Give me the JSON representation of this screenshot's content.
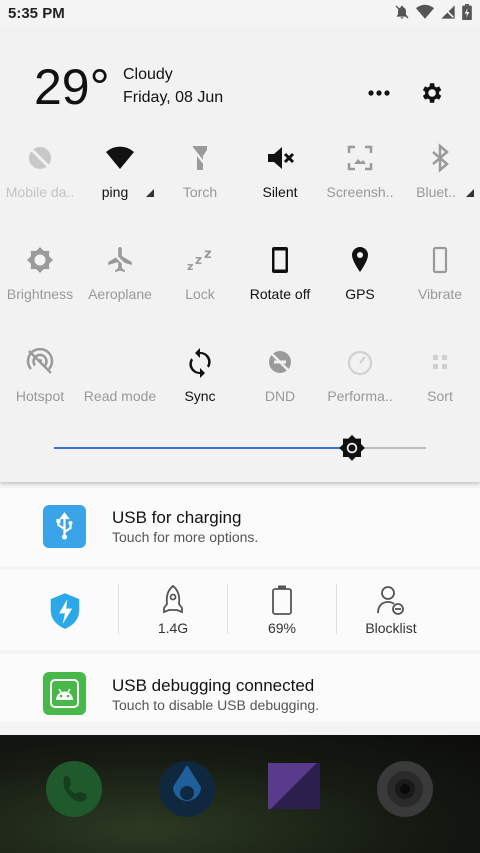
{
  "status_bar": {
    "time": "5:35 PM"
  },
  "weather": {
    "temperature": "29°",
    "condition": "Cloudy",
    "date": "Friday, 08 Jun"
  },
  "quick_tiles": [
    {
      "label": "Mobile da..",
      "icon": "mobile-data-off-icon",
      "active": false
    },
    {
      "label": "ping",
      "icon": "wifi-icon",
      "active": true,
      "expandable": true
    },
    {
      "label": "Torch",
      "icon": "torch-icon",
      "active": false
    },
    {
      "label": "Silent",
      "icon": "volume-off-icon",
      "active": true
    },
    {
      "label": "Screensh..",
      "icon": "screenshot-icon",
      "active": false
    },
    {
      "label": "Bluet..",
      "icon": "bluetooth-icon",
      "active": false,
      "expandable": true
    },
    {
      "label": "Brightness",
      "icon": "brightness-icon",
      "active": false
    },
    {
      "label": "Aeroplane",
      "icon": "airplane-icon",
      "active": false
    },
    {
      "label": "Lock",
      "icon": "sleep-lock-icon",
      "active": false
    },
    {
      "label": "Rotate off",
      "icon": "rotate-phone-icon",
      "active": true
    },
    {
      "label": "GPS",
      "icon": "location-pin-icon",
      "active": true
    },
    {
      "label": "Vibrate",
      "icon": "vibrate-icon",
      "active": false
    },
    {
      "label": "Hotspot",
      "icon": "hotspot-off-icon",
      "active": false
    },
    {
      "label": "Read mode",
      "icon": "moon-icon",
      "active": false
    },
    {
      "label": "Sync",
      "icon": "sync-icon",
      "active": true
    },
    {
      "label": "DND",
      "icon": "dnd-off-icon",
      "active": false
    },
    {
      "label": "Performa..",
      "icon": "performance-gauge-icon",
      "active": false
    },
    {
      "label": "Sort",
      "icon": "sort-grid-icon",
      "active": false
    }
  ],
  "brightness": {
    "level": 0.8
  },
  "usb_notification": {
    "title": "USB for charging",
    "subtitle": "Touch for more options."
  },
  "tools": [
    {
      "label": "",
      "icon": "security-shield-icon"
    },
    {
      "label": "1.4G",
      "icon": "rocket-icon"
    },
    {
      "label": "69%",
      "icon": "battery-icon"
    },
    {
      "label": "Blocklist",
      "icon": "block-user-icon"
    }
  ],
  "debug_notification": {
    "title": "USB debugging connected",
    "subtitle": "Touch to disable USB debugging."
  },
  "colors": {
    "accent": "#3a73d6",
    "usb_icon_bg": "#3ba3e8",
    "debug_icon_bg": "#48b84a"
  }
}
